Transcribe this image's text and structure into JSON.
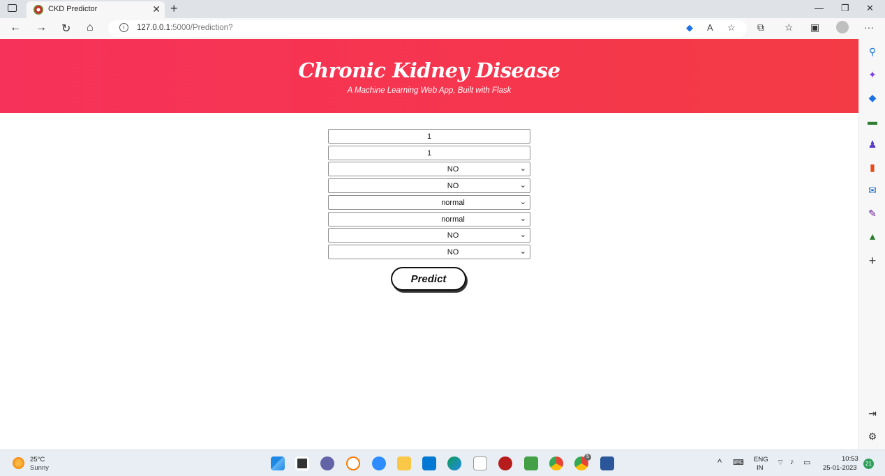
{
  "browser": {
    "tab_title": "CKD Predictor",
    "url_host": "127.0.0.1",
    "url_path": ":5000/Prediction?"
  },
  "hero": {
    "title": "Chronic Kidney Disease",
    "subtitle": "A Machine Learning Web App, Built with Flask"
  },
  "form": {
    "inputs": [
      "1",
      "1"
    ],
    "selects": [
      "NO",
      "NO",
      "normal",
      "normal",
      "NO",
      "NO"
    ],
    "predict_label": "Predict"
  },
  "taskbar": {
    "temperature": "25°C",
    "condition": "Sunny",
    "language_top": "ENG",
    "language_bottom": "IN",
    "time": "10:53",
    "date": "25-01-2023",
    "notification_count": "21",
    "chrome_badge": "5"
  },
  "colors": {
    "hero": "#f5364d",
    "accent_blue": "#1a73e8"
  }
}
